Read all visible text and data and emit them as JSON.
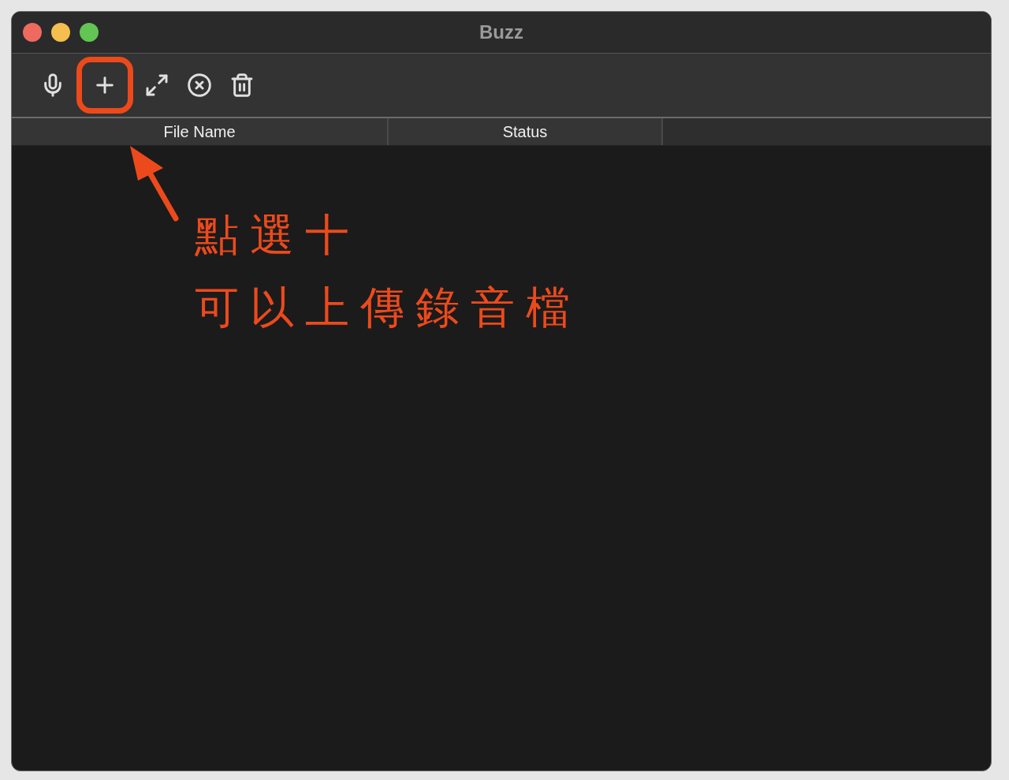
{
  "window": {
    "title": "Buzz"
  },
  "toolbar": [
    {
      "kind": "record",
      "highlighted": false
    },
    {
      "kind": "add",
      "highlighted": true
    },
    {
      "kind": "expand",
      "highlighted": false
    },
    {
      "kind": "cancel",
      "highlighted": false
    },
    {
      "kind": "delete",
      "highlighted": false
    }
  ],
  "table": {
    "columns": [
      "File Name",
      "Status"
    ]
  },
  "annotation": {
    "lines": [
      "點選十",
      "可以上傳錄音檔"
    ]
  }
}
